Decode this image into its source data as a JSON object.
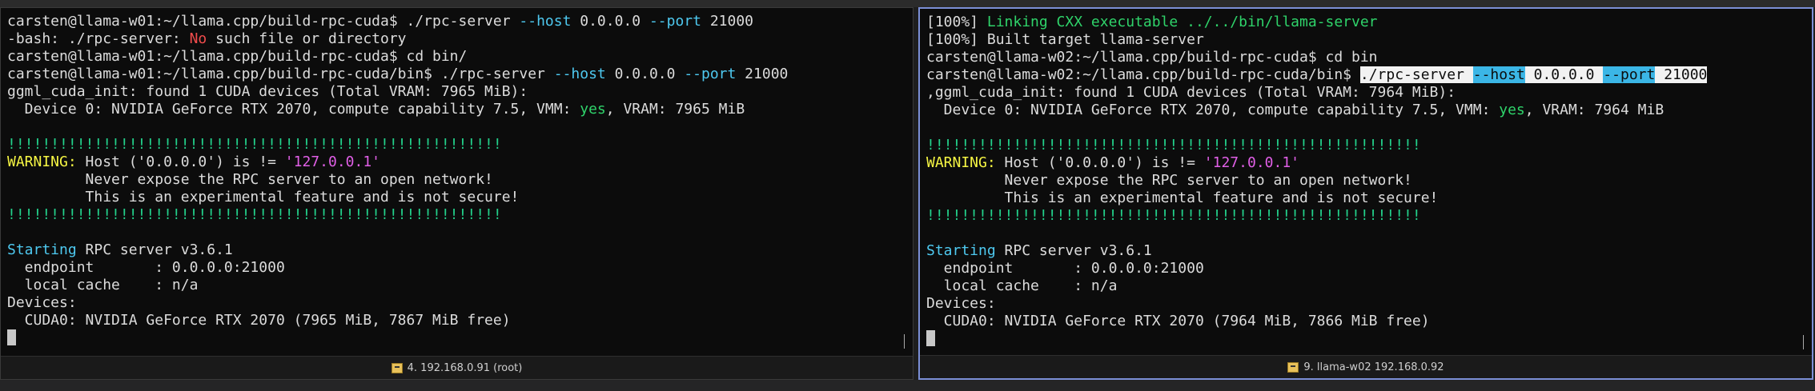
{
  "left": {
    "lines": [
      [
        {
          "t": "carsten@llama-w01:~/llama.cpp/build-rpc-cuda$ ./rpc-server "
        },
        {
          "t": "--host",
          "c": "c-cyan"
        },
        {
          "t": " 0.0.0.0 "
        },
        {
          "t": "--port",
          "c": "c-cyan"
        },
        {
          "t": " 21000"
        }
      ],
      [
        {
          "t": "-bash: ./rpc-server: "
        },
        {
          "t": "No",
          "c": "c-red"
        },
        {
          "t": " such file or directory"
        }
      ],
      [
        {
          "t": "carsten@llama-w01:~/llama.cpp/build-rpc-cuda$ cd bin/"
        }
      ],
      [
        {
          "t": "carsten@llama-w01:~/llama.cpp/build-rpc-cuda/bin$ ./rpc-server "
        },
        {
          "t": "--host",
          "c": "c-cyan"
        },
        {
          "t": " 0.0.0.0 "
        },
        {
          "t": "--port",
          "c": "c-cyan"
        },
        {
          "t": " 21000"
        }
      ],
      [
        {
          "t": "ggml_cuda_init: found 1 CUDA devices (Total VRAM: 7965 MiB):"
        }
      ],
      [
        {
          "t": "  Device 0: NVIDIA GeForce RTX 2070, compute capability 7.5, VMM: "
        },
        {
          "t": "yes",
          "c": "c-green"
        },
        {
          "t": ", VRAM: 7965 MiB"
        }
      ],
      [],
      [
        {
          "t": "!!!!!!!!!!!!!!!!!!!!!!!!!!!!!!!!!!!!!!!!!!!!!!!!!!!!!!!!!",
          "c": "c-bang"
        }
      ],
      [
        {
          "t": "WARNING:",
          "c": "c-yellow"
        },
        {
          "t": " Host ('0.0.0.0') is != "
        },
        {
          "t": "'127.0.0.1'",
          "c": "c-magenta"
        }
      ],
      [
        {
          "t": "         Never expose the RPC server to an open network!"
        }
      ],
      [
        {
          "t": "         This is an experimental feature and is not secure!"
        }
      ],
      [
        {
          "t": "!!!!!!!!!!!!!!!!!!!!!!!!!!!!!!!!!!!!!!!!!!!!!!!!!!!!!!!!!",
          "c": "c-bang"
        }
      ],
      [],
      [
        {
          "t": "Starting",
          "c": "c-cyan"
        },
        {
          "t": " RPC server v3.6.1"
        }
      ],
      [
        {
          "t": "  endpoint       : 0.0.0.0:21000"
        }
      ],
      [
        {
          "t": "  local cache    : n/a"
        }
      ],
      [
        {
          "t": "Devices:"
        }
      ],
      [
        {
          "t": "  CUDA0: NVIDIA GeForce RTX 2070 (7965 MiB, 7867 MiB free)"
        }
      ]
    ],
    "status_label": "4. 192.168.0.91 (root)",
    "tab_icon": "terminal-tab-icon"
  },
  "right": {
    "lines": [
      [
        {
          "t": "[100%] "
        },
        {
          "t": "Linking CXX executable ../../bin/llama-server",
          "c": "c-green"
        }
      ],
      [
        {
          "t": "[100%] Built target llama-server"
        }
      ],
      [
        {
          "t": "carsten@llama-w02:~/llama.cpp/build-rpc-cuda$ cd bin"
        }
      ],
      [
        {
          "t": "carsten@llama-w02:~/llama.cpp/build-rpc-cuda/bin$ "
        },
        {
          "t": "./rpc-server ",
          "c": "sel-white"
        },
        {
          "t": "--host",
          "c": "sel-cyan"
        },
        {
          "t": " 0.0.0.0 ",
          "c": "sel-white"
        },
        {
          "t": "--port",
          "c": "sel-cyan"
        },
        {
          "t": " 21000",
          "c": "sel-white"
        }
      ],
      [
        {
          "t": ",ggml_cuda_init: found 1 CUDA devices (Total VRAM: 7964 MiB):"
        }
      ],
      [
        {
          "t": "  Device 0: NVIDIA GeForce RTX 2070, compute capability 7.5, VMM: "
        },
        {
          "t": "yes",
          "c": "c-green"
        },
        {
          "t": ", VRAM: 7964 MiB"
        }
      ],
      [],
      [
        {
          "t": "!!!!!!!!!!!!!!!!!!!!!!!!!!!!!!!!!!!!!!!!!!!!!!!!!!!!!!!!!",
          "c": "c-bang"
        }
      ],
      [
        {
          "t": "WARNING:",
          "c": "c-yellow"
        },
        {
          "t": " Host ('0.0.0.0') is != "
        },
        {
          "t": "'127.0.0.1'",
          "c": "c-magenta"
        }
      ],
      [
        {
          "t": "         Never expose the RPC server to an open network!"
        }
      ],
      [
        {
          "t": "         This is an experimental feature and is not secure!"
        }
      ],
      [
        {
          "t": "!!!!!!!!!!!!!!!!!!!!!!!!!!!!!!!!!!!!!!!!!!!!!!!!!!!!!!!!!",
          "c": "c-bang"
        }
      ],
      [],
      [
        {
          "t": "Starting",
          "c": "c-cyan"
        },
        {
          "t": " RPC server v3.6.1"
        }
      ],
      [
        {
          "t": "  endpoint       : 0.0.0.0:21000"
        }
      ],
      [
        {
          "t": "  local cache    : n/a"
        }
      ],
      [
        {
          "t": "Devices:"
        }
      ],
      [
        {
          "t": "  CUDA0: NVIDIA GeForce RTX 2070 (7964 MiB, 7866 MiB free)"
        }
      ]
    ],
    "status_label": "9. llama-w02 192.168.0.92",
    "tab_icon": "terminal-tab-icon"
  },
  "colors": {
    "terminal_bg": "#0c0c0c",
    "active_border": "#7b8fd6",
    "prompt_text": "#dcdcdc",
    "option_cyan": "#4ec9f0",
    "error_red": "#f14c4c",
    "ok_green": "#2fd36a",
    "warning_yellow": "#f5f543",
    "address_magenta": "#e05fe6"
  }
}
